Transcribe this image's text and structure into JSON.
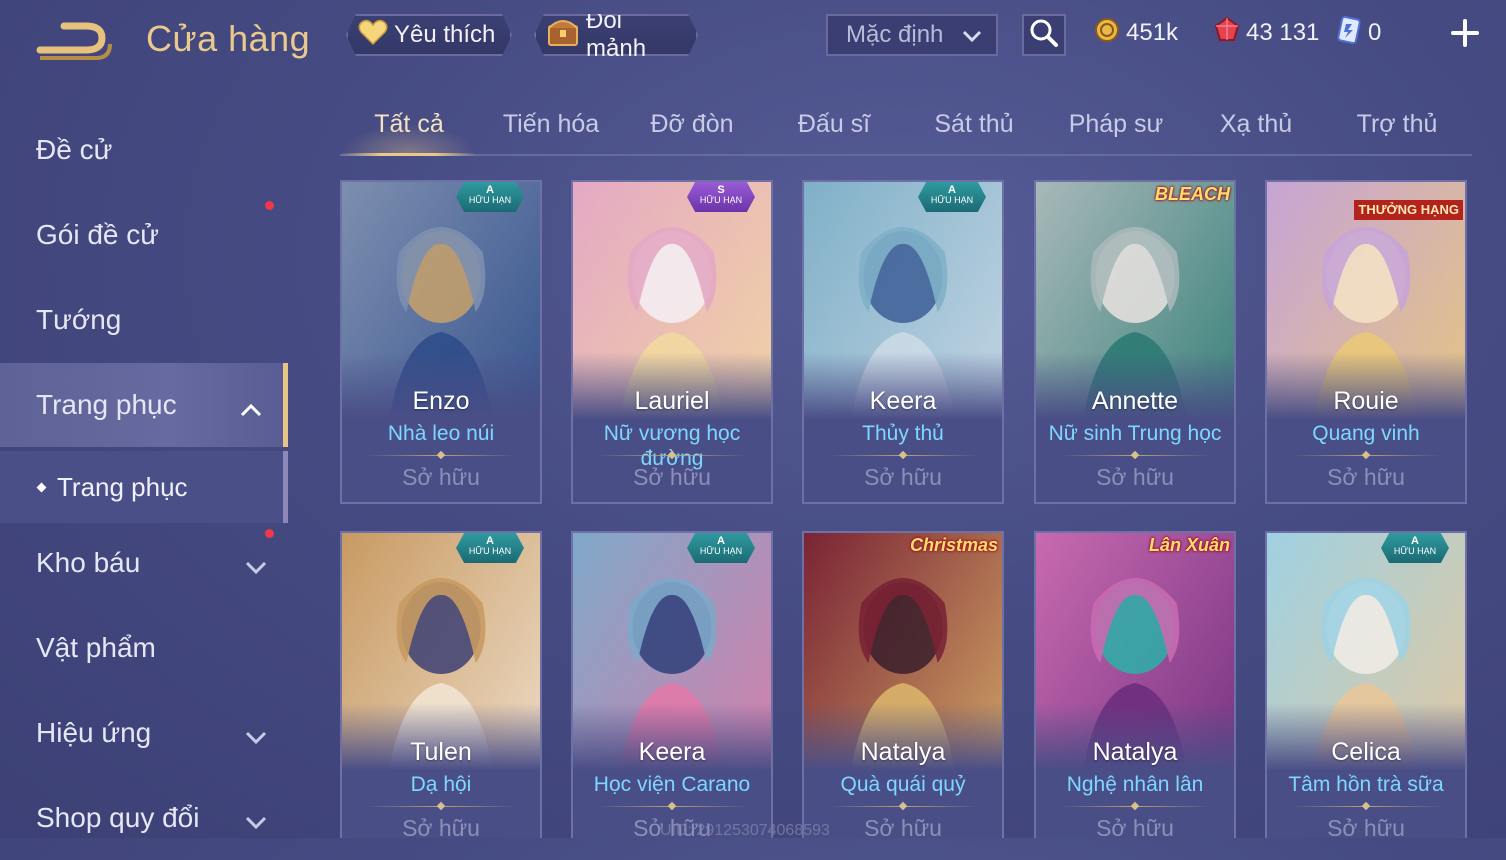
{
  "header": {
    "title": "Cửa hàng",
    "favorite_label": "Yêu thích",
    "shard_exchange_label": "Đổi mảnh",
    "sort_value": "Mặc định",
    "currencies": {
      "gold": "451k",
      "ruby": "43 131",
      "voucher": "0"
    }
  },
  "sidebar": {
    "items": [
      {
        "label": "Đề cử"
      },
      {
        "label": "Gói đề cử"
      },
      {
        "label": "Tướng"
      },
      {
        "label": "Trang phục"
      },
      {
        "label": "Trang phục"
      },
      {
        "label": "Kho báu"
      },
      {
        "label": "Vật phẩm"
      },
      {
        "label": "Hiệu ứng"
      },
      {
        "label": "Shop quy đổi"
      }
    ]
  },
  "tabs": [
    "Tất cả",
    "Tiến hóa",
    "Đỡ đòn",
    "Đấu sĩ",
    "Sát thủ",
    "Pháp sư",
    "Xạ thủ",
    "Trợ thủ"
  ],
  "owned_label": "Sở hữu",
  "limited_label": "HỮU HẠN",
  "cards": [
    {
      "hero": "Enzo",
      "skin": "Nhà leo núi",
      "badge": "A",
      "colors": [
        "#7d8fb0",
        "#2f4d8a",
        "#c7a16a"
      ]
    },
    {
      "hero": "Lauriel",
      "skin": "Nữ vương học đường",
      "badge": "S",
      "colors": [
        "#e4a9c4",
        "#f3d8a0",
        "#f5f0f5"
      ]
    },
    {
      "hero": "Keera",
      "skin": "Thủy thủ",
      "badge": "A",
      "colors": [
        "#7fb0c8",
        "#cbd9e6",
        "#3d5e96"
      ]
    },
    {
      "hero": "Annette",
      "skin": "Nữ sinh Trung học",
      "badge": "",
      "event": "BLEACH",
      "colors": [
        "#a8b8b9",
        "#2c7b73",
        "#e9e3e0"
      ]
    },
    {
      "hero": "Rouie",
      "skin": "Quang vinh",
      "badge": "",
      "rank": "THƯỞNG HẠNG",
      "colors": [
        "#c6a4d6",
        "#e9c879",
        "#f4e3c6"
      ]
    },
    {
      "hero": "Tulen",
      "skin": "Dạ hội",
      "badge": "A",
      "colors": [
        "#c89a62",
        "#f1e3d2",
        "#3d3f74"
      ]
    },
    {
      "hero": "Keera",
      "skin": "Học viện Carano",
      "badge": "A",
      "colors": [
        "#7ea8c9",
        "#e07aa8",
        "#2f3f7a"
      ]
    },
    {
      "hero": "Natalya",
      "skin": "Quà quái quỷ",
      "badge": "",
      "event": "Christmas",
      "colors": [
        "#7a2335",
        "#d9b26a",
        "#3b1e2c"
      ]
    },
    {
      "hero": "Natalya",
      "skin": "Nghệ nhân lân",
      "badge": "",
      "event": "Lân Xuân",
      "colors": [
        "#c86ab0",
        "#6e2e7d",
        "#2cb0a8"
      ]
    },
    {
      "hero": "Celica",
      "skin": "Tâm hồn trà sữa",
      "badge": "A",
      "colors": [
        "#9fd1e2",
        "#e8c79a",
        "#f1ece6"
      ]
    }
  ],
  "uid_text": "UID: 291253074068593"
}
